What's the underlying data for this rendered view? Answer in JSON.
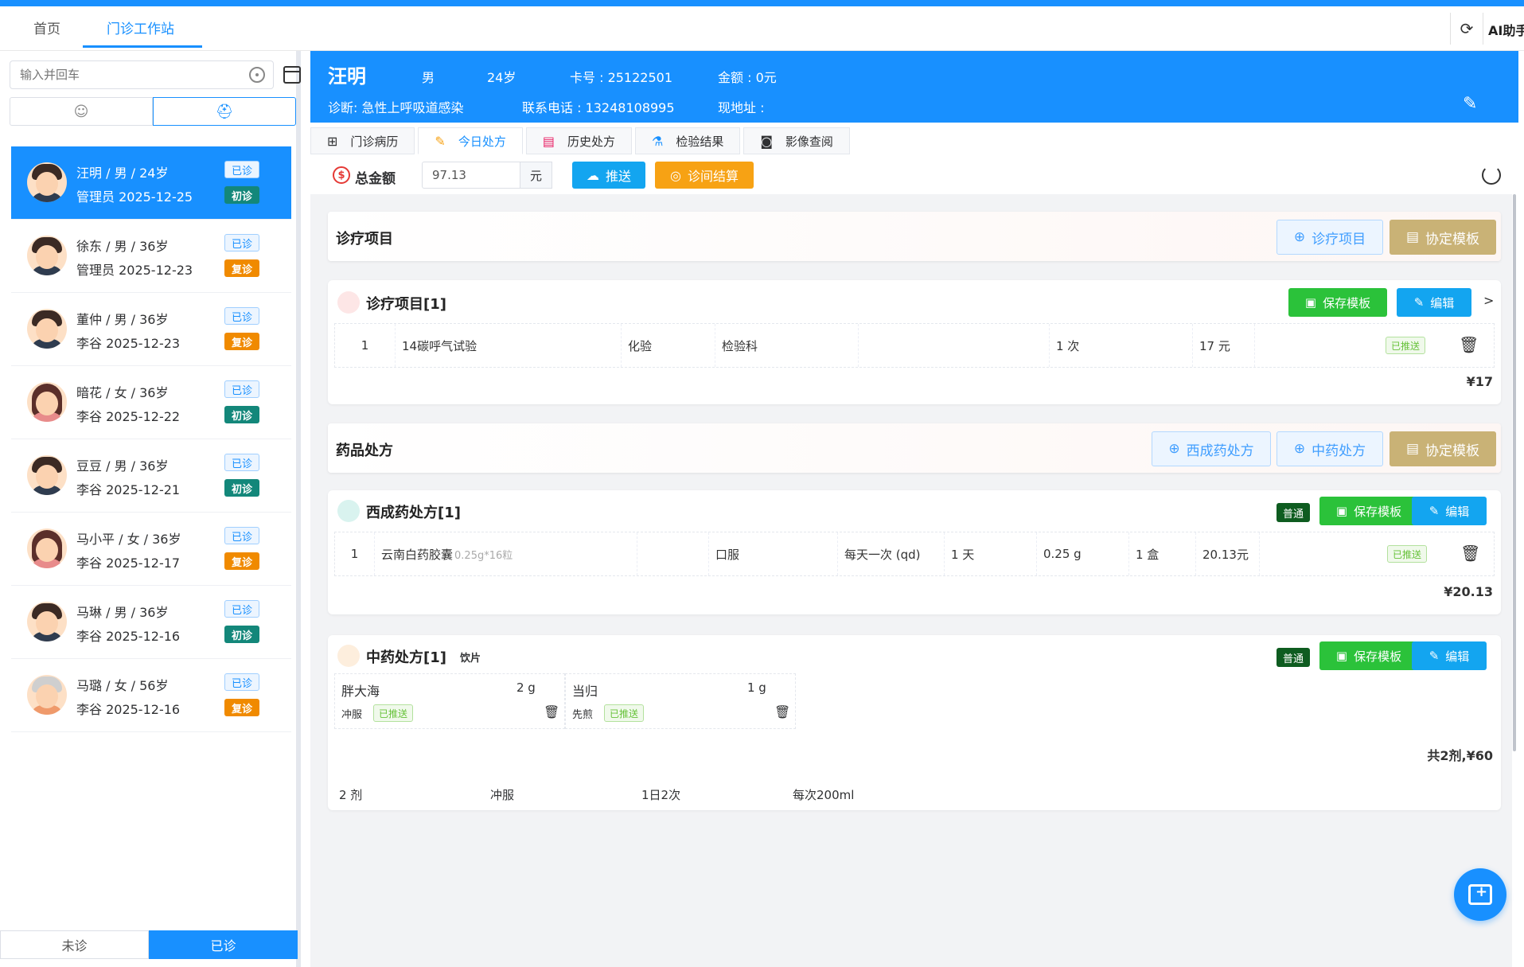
{
  "nav": {
    "tabs": [
      {
        "label": "首页"
      },
      {
        "label": "门诊工作站"
      }
    ],
    "ai_label": "AI助手"
  },
  "sidebar": {
    "search_placeholder": "输入并回车",
    "patients": [
      {
        "name": "汪明 / 男 / 24岁",
        "meta": "管理员 2025-12-25",
        "status": "已诊",
        "type": "初诊"
      },
      {
        "name": "徐东 / 男 / 36岁",
        "meta": "管理员 2025-12-23",
        "status": "已诊",
        "type": "复诊"
      },
      {
        "name": "董仲 / 男 / 36岁",
        "meta": "李谷 2025-12-23",
        "status": "已诊",
        "type": "复诊"
      },
      {
        "name": "暗花 / 女 / 36岁",
        "meta": "李谷 2025-12-22",
        "status": "已诊",
        "type": "初诊"
      },
      {
        "name": "豆豆 / 男 / 36岁",
        "meta": "李谷 2025-12-21",
        "status": "已诊",
        "type": "初诊"
      },
      {
        "name": "马小平 / 女 / 36岁",
        "meta": "李谷 2025-12-17",
        "status": "已诊",
        "type": "复诊"
      },
      {
        "name": "马琳 / 男 / 36岁",
        "meta": "李谷 2025-12-16",
        "status": "已诊",
        "type": "初诊"
      },
      {
        "name": "马璐 / 女 / 56岁",
        "meta": "李谷 2025-12-16",
        "status": "已诊",
        "type": "复诊"
      }
    ],
    "bottom_tabs": [
      {
        "label": "未诊"
      },
      {
        "label": "已诊"
      }
    ]
  },
  "header": {
    "name": "汪明",
    "gender": "男",
    "age": "24岁",
    "card": "卡号 : 25122501",
    "balance": "金额 : 0元",
    "diagnosis": "诊断: 急性上呼吸道感染",
    "phone": "联系电话 : 13248108995",
    "address": "现地址 :"
  },
  "subtabs": [
    {
      "label": "门诊病历"
    },
    {
      "label": "今日处方"
    },
    {
      "label": "历史处方"
    },
    {
      "label": "检验结果"
    },
    {
      "label": "影像查阅"
    }
  ],
  "totals": {
    "label": "总金额",
    "amount": "97.13",
    "unit": "元",
    "push_label": "推送",
    "settle_label": "诊间结算"
  },
  "treatment": {
    "section_title": "诊疗项目",
    "add_label": "诊疗项目",
    "template_label": "协定模板",
    "card_title": "诊疗项目[1]",
    "save_label": "保存模板",
    "edit_label": "编辑",
    "row": {
      "no": "1",
      "name": "14碳呼气试验",
      "category": "化验",
      "dept": "检验科",
      "qty": "1 次",
      "price": "17 元",
      "status": "已推送"
    },
    "sum": "¥17"
  },
  "drug": {
    "section_title": "药品处方",
    "west_label": "西成药处方",
    "herbal_label": "中药处方",
    "template_label": "协定模板",
    "west_card": {
      "title": "西成药处方[1]",
      "tag": "普通",
      "save_label": "保存模板",
      "edit_label": "编辑",
      "row": {
        "no": "1",
        "name": "云南白药胶囊",
        "spec": "0.25g*16粒",
        "route": "口服",
        "freq": "每天一次 (qd)",
        "days": "1 天",
        "dose": "0.25 g",
        "qty": "1 盒",
        "price": "20.13元",
        "status": "已推送"
      },
      "sum": "¥20.13"
    },
    "herbal_card": {
      "title": "中药处方[1]",
      "subtitle": "饮片",
      "tag": "普通",
      "save_label": "保存模板",
      "edit_label": "编辑",
      "herbs": [
        {
          "name": "胖大海",
          "qty": "2 g",
          "method": "冲服",
          "status": "已推送"
        },
        {
          "name": "当归",
          "qty": "1 g",
          "method": "先煎",
          "status": "已推送"
        }
      ],
      "sum": "共2剂,¥60",
      "footer": {
        "doses": "2 剂",
        "method": "冲服",
        "freq": "1日2次",
        "amount": "每次200ml"
      }
    }
  },
  "colors": {
    "primary": "#1890ff",
    "green": "#2bc23a",
    "orange": "#f7a214",
    "tan": "#c9b276"
  }
}
